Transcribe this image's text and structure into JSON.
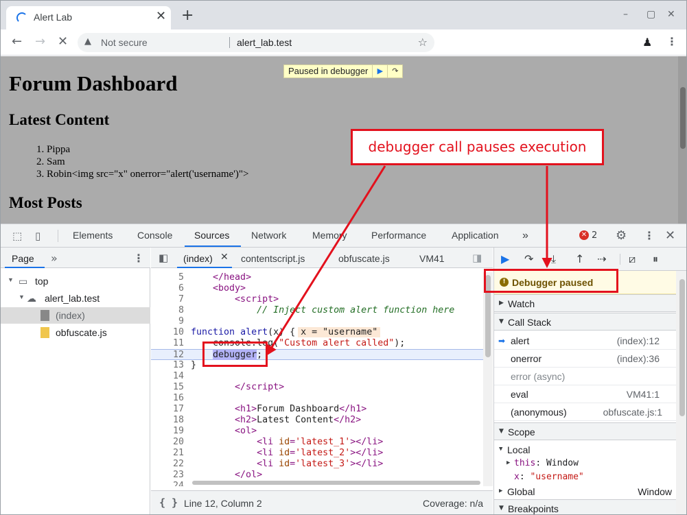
{
  "browser": {
    "tab_title": "Alert Lab",
    "tab_close": "✕",
    "new_tab": "+",
    "security_label": "Not secure",
    "url": "alert_lab.test",
    "window_controls": [
      "–",
      "▢",
      "✕"
    ]
  },
  "page": {
    "title": "Forum Dashboard",
    "latest_heading": "Latest Content",
    "latest_items": [
      "1. Pippa",
      "2. Sam",
      "3. Robin<img src=\"x\" onerror=\"alert('username')\">"
    ],
    "most_heading": "Most Posts",
    "paused_overlay_label": "Paused in debugger"
  },
  "devtools": {
    "tabs": [
      "Elements",
      "Console",
      "Sources",
      "Network",
      "Memory",
      "Performance",
      "Application"
    ],
    "active_tab": "Sources",
    "overflow": "»",
    "error_count": "2",
    "navigator": {
      "tab": "Page",
      "chevron": "»",
      "tree": {
        "top": "top",
        "domain": "alert_lab.test",
        "files": [
          "(index)",
          "obfuscate.js"
        ]
      }
    },
    "editor": {
      "tabs": [
        "(index)",
        "contentscript.js",
        "obfuscate.js",
        "VM41"
      ],
      "active_tab": "(index)",
      "highlighted_line": 12,
      "inline_value": "x = \"username\"",
      "status_format": "{ }",
      "status_position": "Line 12, Column 2",
      "status_coverage": "Coverage: n/a"
    },
    "sidebar": {
      "paused_message": "Debugger paused",
      "sections": {
        "watch": "Watch",
        "call_stack": "Call Stack",
        "scope": "Scope",
        "breakpoints": "Breakpoints"
      },
      "call_stack": [
        {
          "fn": "alert",
          "loc": "(index):12"
        },
        {
          "fn": "onerror",
          "loc": "(index):36"
        },
        {
          "fn": "error (async)",
          "loc": ""
        },
        {
          "fn": "eval",
          "loc": "VM41:1"
        },
        {
          "fn": "(anonymous)",
          "loc": "obfuscate.js:1"
        }
      ],
      "scope": {
        "local_label": "Local",
        "this_key": "this",
        "this_value": "Window",
        "x_key": "x",
        "x_value": "\"username\"",
        "global_label": "Global",
        "global_value": "Window"
      }
    }
  },
  "annotation": {
    "label": "debugger call pauses execution",
    "color": "#e3111d"
  },
  "colors": {
    "accent": "#1a73e8",
    "paused_overlay": "#ffffc6",
    "paused_banner": "#fffbe5",
    "annotation_red": "#e3111d"
  }
}
